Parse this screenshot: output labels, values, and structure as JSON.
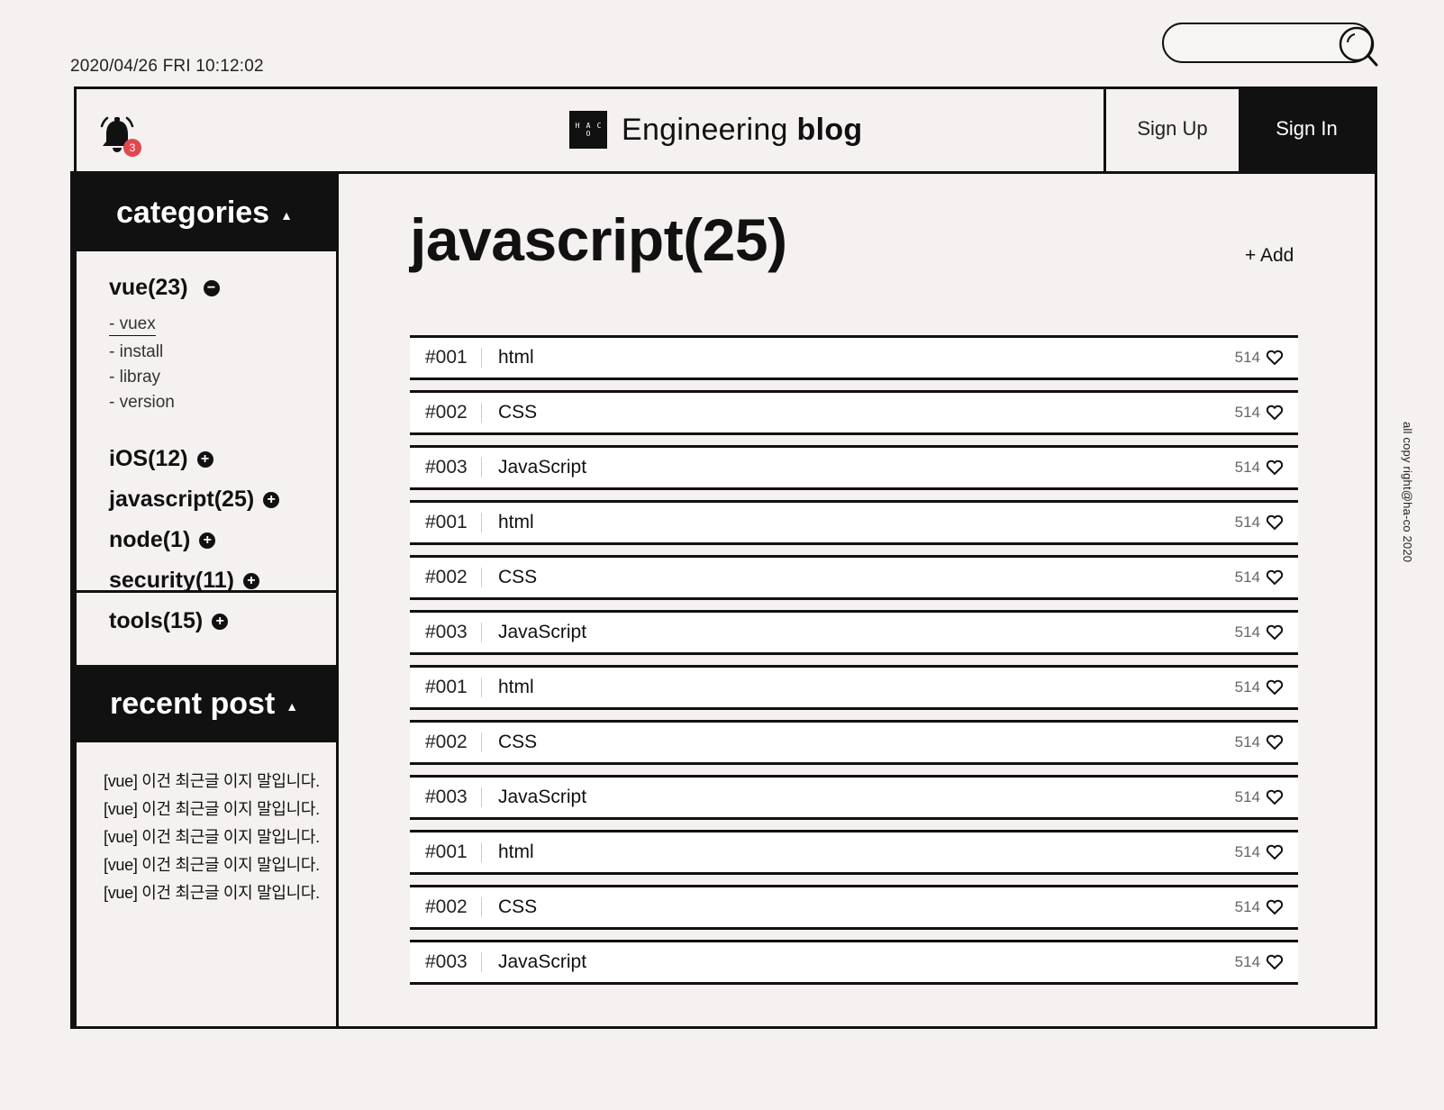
{
  "datetime": "2020/04/26 FRI 10:12:02",
  "search": {
    "placeholder": "",
    "icon": "search-icon"
  },
  "header": {
    "notification_count": "3",
    "logo_text": [
      "H",
      "A",
      "C",
      "O"
    ],
    "brand_light": "Engineering",
    "brand_bold": "blog",
    "signup_label": "Sign Up",
    "signin_label": "Sign In"
  },
  "sidebar": {
    "categories_title": "categories",
    "caret": "▲",
    "open_category": {
      "label": "vue(23)",
      "toggle": "−"
    },
    "sub_items": [
      "- vuex",
      "- install",
      "- libray",
      "- version"
    ],
    "closed_categories": [
      {
        "label": "iOS(12)",
        "toggle": "+"
      },
      {
        "label": "javascript(25)",
        "toggle": "+"
      },
      {
        "label": "node(1)",
        "toggle": "+"
      },
      {
        "label": "security(11)",
        "toggle": "+"
      },
      {
        "label": "tools(15)",
        "toggle": "+"
      }
    ],
    "recent_title": "recent post",
    "recent_posts": [
      "[vue] 이건 최근글 이지 말입니다.",
      "[vue] 이건 최근글 이지 말입니다.",
      "[vue] 이건 최근글 이지 말입니다.",
      "[vue] 이건 최근글 이지 말입니다.",
      "[vue] 이건 최근글 이지 말입니다."
    ]
  },
  "main": {
    "title": "javascript(25)",
    "add_label": "+ Add",
    "posts": [
      {
        "num": "#001",
        "title": "html",
        "likes": "514"
      },
      {
        "num": "#002",
        "title": "CSS",
        "likes": "514"
      },
      {
        "num": "#003",
        "title": "JavaScript",
        "likes": "514"
      },
      {
        "num": "#001",
        "title": "html",
        "likes": "514"
      },
      {
        "num": "#002",
        "title": "CSS",
        "likes": "514"
      },
      {
        "num": "#003",
        "title": "JavaScript",
        "likes": "514"
      },
      {
        "num": "#001",
        "title": "html",
        "likes": "514"
      },
      {
        "num": "#002",
        "title": "CSS",
        "likes": "514"
      },
      {
        "num": "#003",
        "title": "JavaScript",
        "likes": "514"
      },
      {
        "num": "#001",
        "title": "html",
        "likes": "514"
      },
      {
        "num": "#002",
        "title": "CSS",
        "likes": "514"
      },
      {
        "num": "#003",
        "title": "JavaScript",
        "likes": "514"
      }
    ]
  },
  "copyright": "all copy right@ha-co 2020",
  "colors": {
    "accent": "#111111",
    "badge": "#e0484f",
    "background": "#f4f1f0"
  }
}
